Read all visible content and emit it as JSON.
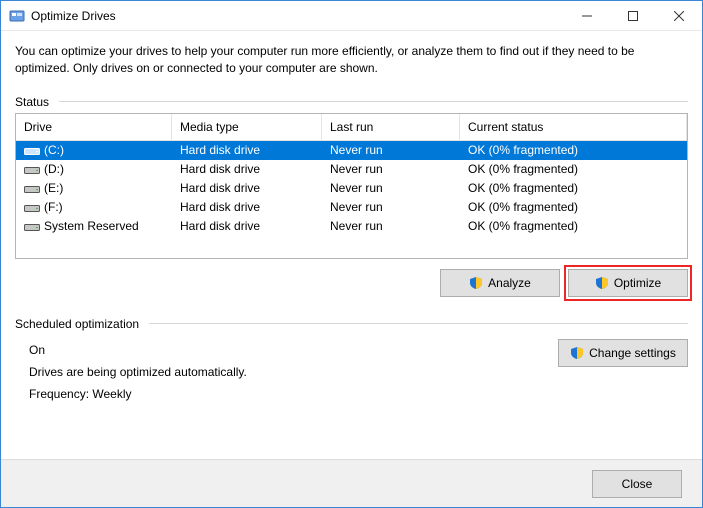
{
  "window": {
    "title": "Optimize Drives"
  },
  "description": "You can optimize your drives to help your computer run more efficiently, or analyze them to find out if they need to be optimized. Only drives on or connected to your computer are shown.",
  "status_label": "Status",
  "columns": {
    "drive": "Drive",
    "media": "Media type",
    "last": "Last run",
    "status": "Current status"
  },
  "drives": [
    {
      "name": "(C:)",
      "media": "Hard disk drive",
      "last": "Never run",
      "status": "OK (0% fragmented)",
      "selected": true,
      "icon": "main"
    },
    {
      "name": "(D:)",
      "media": "Hard disk drive",
      "last": "Never run",
      "status": "OK (0% fragmented)",
      "selected": false,
      "icon": "hdd"
    },
    {
      "name": "(E:)",
      "media": "Hard disk drive",
      "last": "Never run",
      "status": "OK (0% fragmented)",
      "selected": false,
      "icon": "hdd"
    },
    {
      "name": "(F:)",
      "media": "Hard disk drive",
      "last": "Never run",
      "status": "OK (0% fragmented)",
      "selected": false,
      "icon": "hdd"
    },
    {
      "name": "System Reserved",
      "media": "Hard disk drive",
      "last": "Never run",
      "status": "OK (0% fragmented)",
      "selected": false,
      "icon": "hdd"
    }
  ],
  "buttons": {
    "analyze": "Analyze",
    "optimize": "Optimize",
    "change": "Change settings",
    "close": "Close"
  },
  "schedule": {
    "label": "Scheduled optimization",
    "state": "On",
    "info": "Drives are being optimized automatically.",
    "freq": "Frequency: Weekly"
  }
}
